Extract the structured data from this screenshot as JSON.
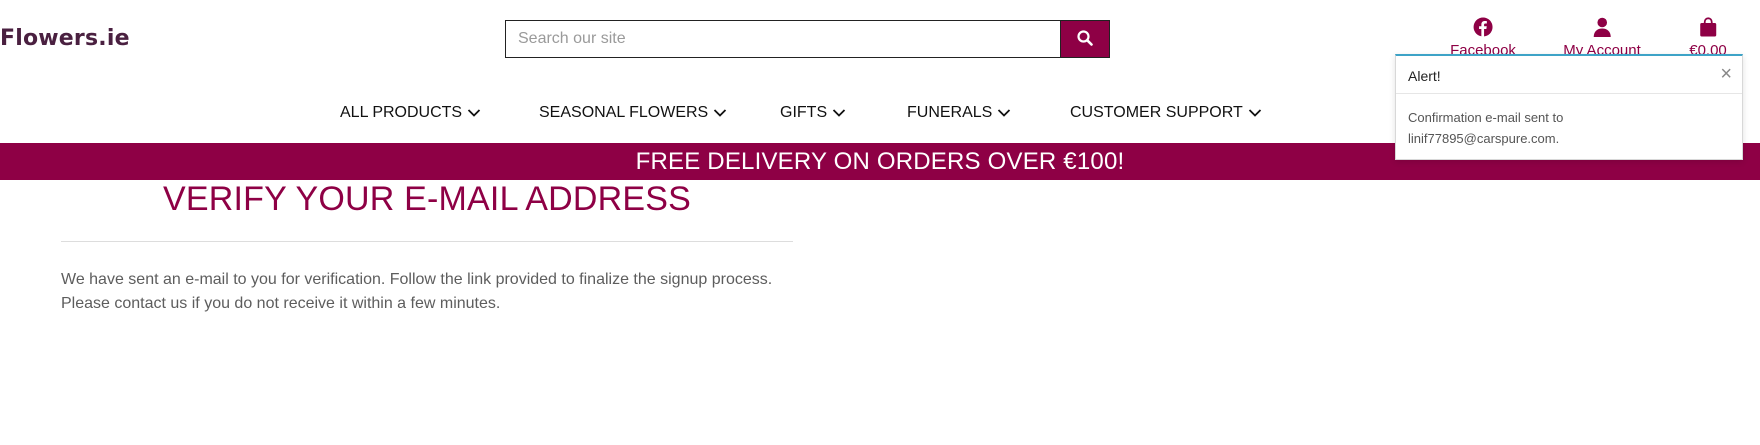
{
  "header": {
    "logo": "Flowers.ie",
    "search": {
      "placeholder": "Search our site",
      "value": ""
    },
    "links": {
      "facebook": "Facebook",
      "account": "My Account",
      "bag_total": "€0.00"
    },
    "icons": {
      "facebook": "facebook-icon",
      "account": "user-icon",
      "bag": "shopping-bag-icon",
      "search": "search-icon"
    }
  },
  "nav": {
    "items": [
      {
        "label": "ALL PRODUCTS"
      },
      {
        "label": "SEASONAL FLOWERS"
      },
      {
        "label": "GIFTS"
      },
      {
        "label": "FUNERALS"
      },
      {
        "label": "CUSTOMER SUPPORT"
      }
    ]
  },
  "banner": {
    "text": "FREE DELIVERY ON ORDERS OVER €100!"
  },
  "main": {
    "title": "VERIFY YOUR E-MAIL ADDRESS",
    "line1": "We have sent an e-mail to you for verification. Follow the link provided to finalize the signup process.",
    "line2": "Please contact us if you do not receive it within a few minutes."
  },
  "toast": {
    "title": "Alert!",
    "close": "×",
    "line1": "Confirmation e-mail sent to",
    "line2": "linif77895@carspure.com."
  },
  "colors": {
    "brand": "#8e0045",
    "logo": "#4a2040",
    "toast_accent": "#3da3c7"
  }
}
